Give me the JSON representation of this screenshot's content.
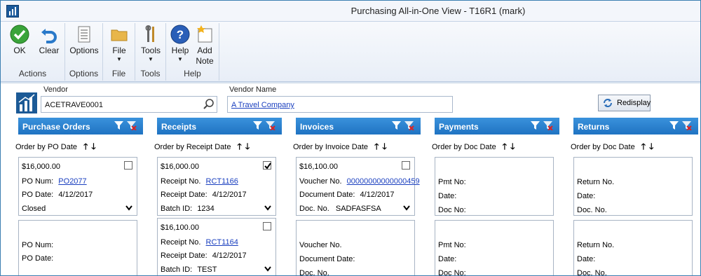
{
  "window": {
    "title": "Purchasing All-in-One View  -  T16R1 (mark)"
  },
  "ribbon": {
    "groups": {
      "actions": "Actions",
      "options": "Options",
      "file": "File",
      "tools": "Tools",
      "help": "Help"
    },
    "buttons": {
      "ok": "OK",
      "clear": "Clear",
      "options": "Options",
      "file": "File",
      "tools": "Tools",
      "help": "Help",
      "add_note_1": "Add",
      "add_note_2": "Note"
    }
  },
  "header": {
    "vendor_label": "Vendor",
    "vendor_value": "ACETRAVE0001",
    "vendor_name_label": "Vendor Name",
    "vendor_name_value": "A Travel Company",
    "redisplay": "Redisplay"
  },
  "columns": {
    "po": {
      "title": "Purchase Orders",
      "order_by": "Order by PO Date",
      "cards": [
        {
          "amount": "$16,000.00",
          "num_label": "PO Num:",
          "num_value": "PO2077",
          "date_label": "PO Date:",
          "date_value": "4/12/2017",
          "status": "Closed",
          "checked": false
        },
        {
          "num_label": "PO Num:",
          "date_label": "PO Date:"
        }
      ]
    },
    "receipts": {
      "title": "Receipts",
      "order_by": "Order by Receipt Date",
      "cards": [
        {
          "amount": "$16,000.00",
          "num_label": "Receipt No.",
          "num_value": "RCT1166",
          "date_label": "Receipt Date:",
          "date_value": "4/12/2017",
          "batch_label": "Batch ID:",
          "batch_value": "1234",
          "checked": true
        },
        {
          "amount": "$16,100.00",
          "num_label": "Receipt No.",
          "num_value": "RCT1164",
          "date_label": "Receipt Date:",
          "date_value": "4/12/2017",
          "batch_label": "Batch ID:",
          "batch_value": "TEST",
          "checked": false
        }
      ]
    },
    "invoices": {
      "title": "Invoices",
      "order_by": "Order by Invoice Date",
      "cards": [
        {
          "amount": "$16,100.00",
          "num_label": "Voucher No.",
          "num_value": "00000000000000459",
          "date_label": "Document Date:",
          "date_value": "4/12/2017",
          "doc_label": "Doc. No.",
          "doc_value": "SADFASFSA",
          "checked": false
        },
        {
          "num_label": "Voucher No.",
          "date_label": "Document Date:",
          "doc_label": "Doc. No."
        }
      ]
    },
    "payments": {
      "title": "Payments",
      "order_by": "Order by Doc Date",
      "cards": [
        {
          "l1": "Pmt No:",
          "l2": "Date:",
          "l3": "Doc No:"
        },
        {
          "l1": "Pmt No:",
          "l2": "Date:",
          "l3": "Doc No:"
        }
      ]
    },
    "returns": {
      "title": "Returns",
      "order_by": "Order by Doc Date",
      "cards": [
        {
          "l1": "Return No.",
          "l2": "Date:",
          "l3": "Doc. No."
        },
        {
          "l1": "Return No.",
          "l2": "Date:",
          "l3": "Doc. No."
        }
      ]
    }
  },
  "arrows": {
    "up": "🡑",
    "down": "🡓"
  }
}
